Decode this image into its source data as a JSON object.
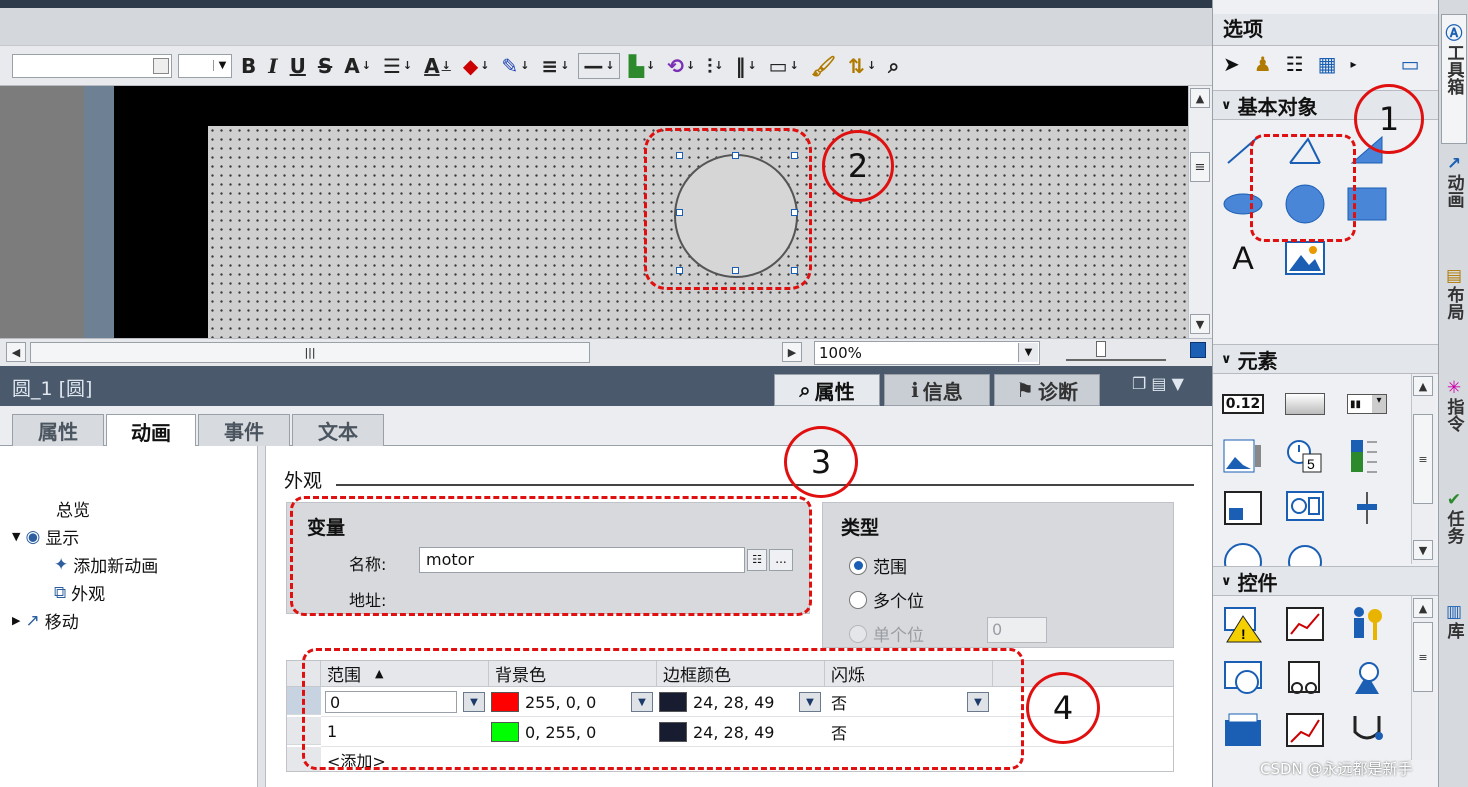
{
  "toolbar": {
    "zoom_field": "100%",
    "buttons": [
      "B",
      "I",
      "U",
      "S",
      "A",
      "A"
    ]
  },
  "panel": {
    "object_title": "圆_1 [圆]",
    "inspector_tabs": [
      "属性",
      "信息",
      "诊断"
    ]
  },
  "prop_tabs": [
    "属性",
    "动画",
    "事件",
    "文本"
  ],
  "nav": {
    "overview": "总览",
    "display": "显示",
    "add_animation": "添加新动画",
    "appearance": "外观",
    "movement": "移动"
  },
  "main": {
    "section_title": "外观",
    "variable_group": "变量",
    "name_label": "名称:",
    "name_value": "motor",
    "address_label": "地址:",
    "type_group": "类型",
    "type_range": "范围",
    "type_multibit": "多个位",
    "type_singlebit": "单个位",
    "singlebit_value": "0"
  },
  "grid": {
    "headers": [
      "范围",
      "背景色",
      "边框颜色",
      "闪烁"
    ],
    "rows": [
      {
        "range": "0",
        "bg_color": "#ff0000",
        "bg_text": "255, 0, 0",
        "border_color": "#181c31",
        "border_text": "24, 28, 49",
        "blink": "否"
      },
      {
        "range": "1",
        "bg_color": "#00ff00",
        "bg_text": "0, 255, 0",
        "border_color": "#181c31",
        "border_text": "24, 28, 49",
        "blink": "否"
      }
    ],
    "add_row": "<添加>"
  },
  "right": {
    "options_title": "选项",
    "basic_objects": "基本对象",
    "elements": "元素",
    "controls": "控件",
    "text_icon": "A",
    "element_value": "0.12"
  },
  "vtabs": [
    "工具箱",
    "动画",
    "布局",
    "指令",
    "任务",
    "库"
  ],
  "annotations": [
    "1",
    "2",
    "3",
    "4"
  ],
  "watermark": "CSDN @永远都是新手",
  "colors": {
    "accent": "#1a5fb4",
    "annotation": "#e01010",
    "panel_header": "#4a5a6c"
  }
}
